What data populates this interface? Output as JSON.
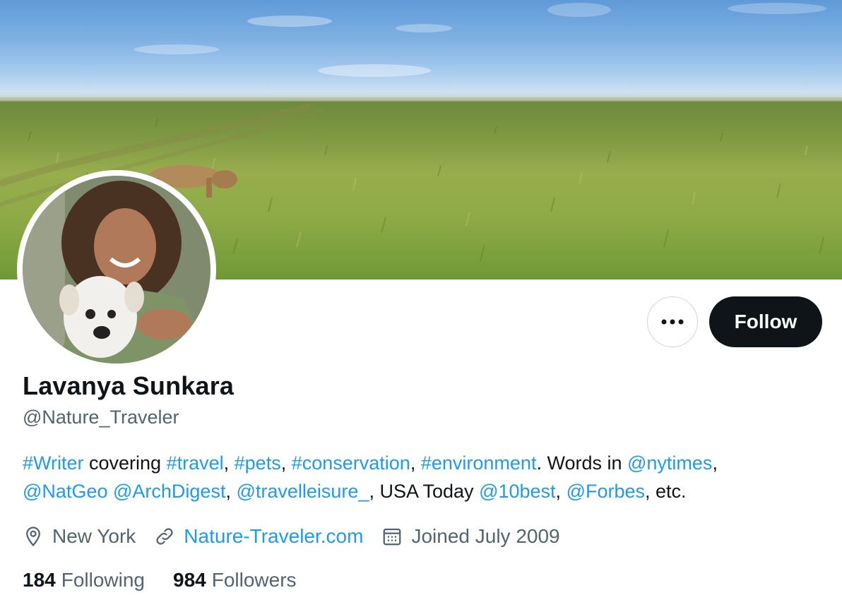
{
  "profile": {
    "name": "Lavanya Sunkara",
    "handle": "@Nature_Traveler"
  },
  "actions": {
    "more_label": "···",
    "follow_label": "Follow"
  },
  "bio": {
    "line1": [
      {
        "text": "#Writer",
        "link": true
      },
      {
        "text": " covering ",
        "link": false
      },
      {
        "text": "#travel",
        "link": true
      },
      {
        "text": ", ",
        "link": false
      },
      {
        "text": "#pets",
        "link": true
      },
      {
        "text": ", ",
        "link": false
      },
      {
        "text": "#conservation",
        "link": true
      },
      {
        "text": ", ",
        "link": false
      },
      {
        "text": "#environment",
        "link": true
      },
      {
        "text": ". Words in ",
        "link": false
      },
      {
        "text": "@nytimes",
        "link": true
      },
      {
        "text": ",",
        "link": false
      }
    ],
    "line2": [
      {
        "text": "@NatGeo",
        "link": true
      },
      {
        "text": " ",
        "link": false
      },
      {
        "text": "@ArchDigest",
        "link": true
      },
      {
        "text": ", ",
        "link": false
      },
      {
        "text": "@travelleisure_",
        "link": true
      },
      {
        "text": ", USA Today ",
        "link": false
      },
      {
        "text": "@10best",
        "link": true
      },
      {
        "text": ", ",
        "link": false
      },
      {
        "text": "@Forbes",
        "link": true
      },
      {
        "text": ", etc.",
        "link": false
      }
    ]
  },
  "meta": {
    "location": "New York",
    "location_icon": "location-pin-icon",
    "website": "Nature-Traveler.com",
    "website_icon": "link-icon",
    "joined": "Joined July 2009",
    "joined_icon": "calendar-icon"
  },
  "stats": {
    "following_count": "184",
    "following_label": "Following",
    "followers_count": "984",
    "followers_label": "Followers"
  },
  "colors": {
    "link": "#1d9bf0",
    "text": "#0f1419",
    "secondary": "#536471",
    "button": "#0f1419"
  }
}
